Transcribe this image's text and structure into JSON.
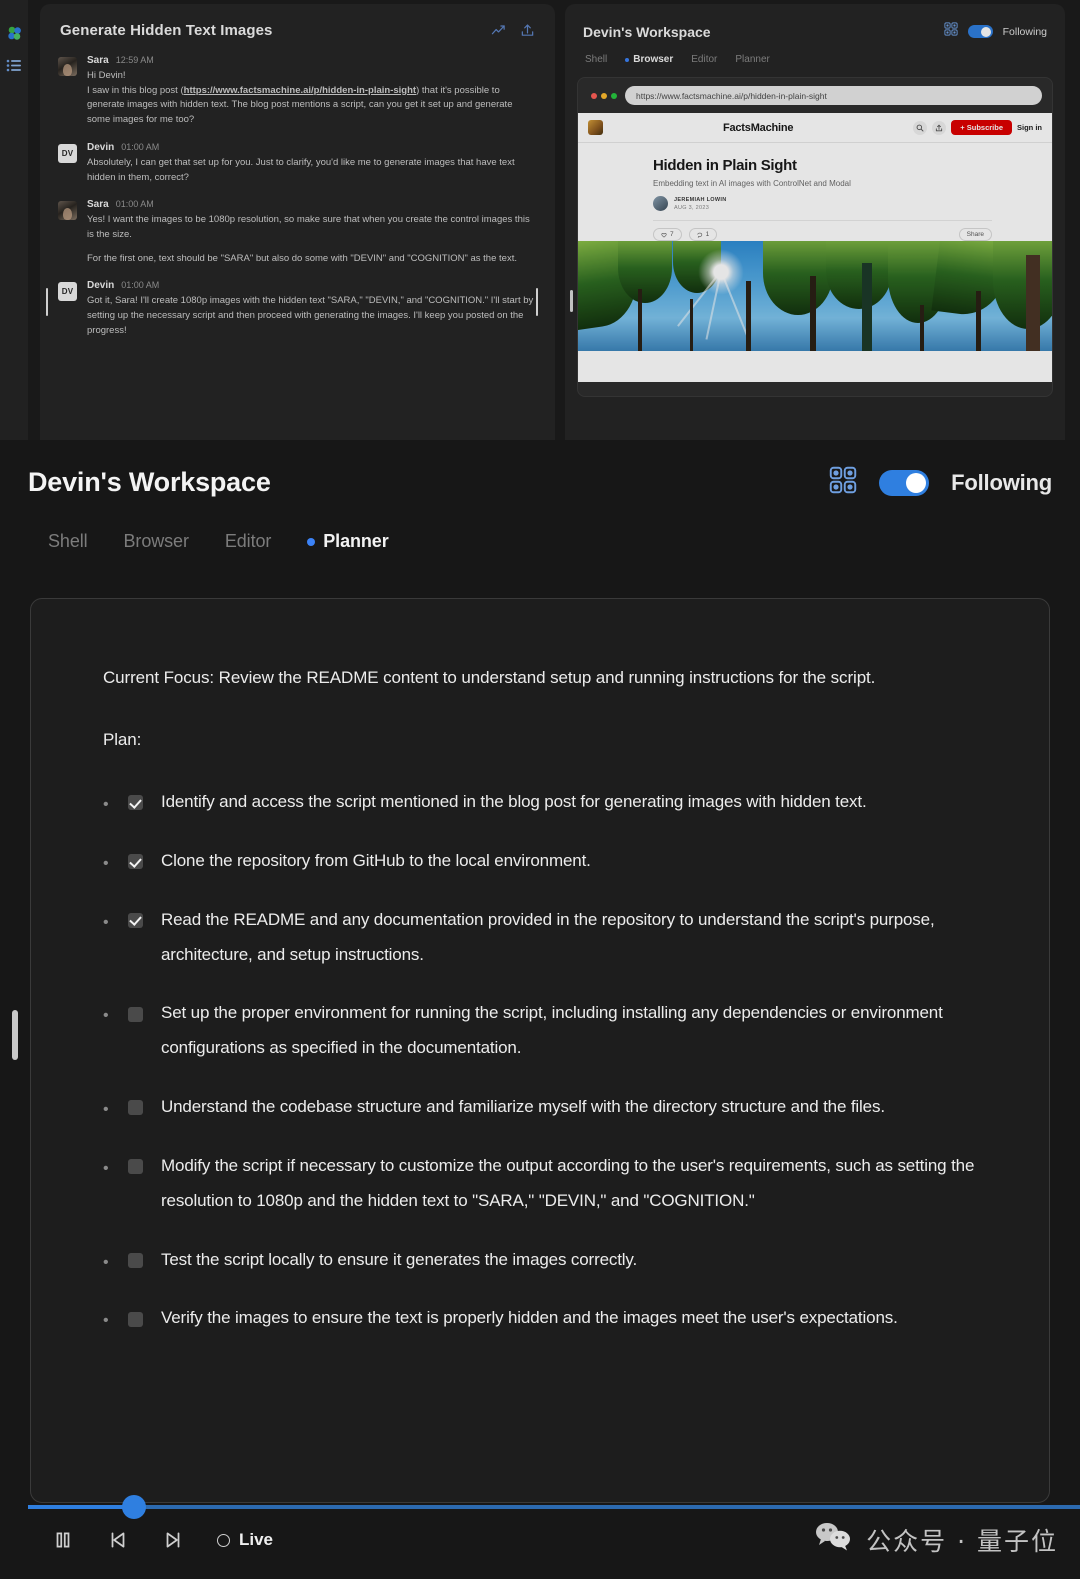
{
  "rail": {
    "logo_icon": "clover-logo-icon",
    "list_icon": "list-icon"
  },
  "chat": {
    "title": "Generate Hidden Text Images",
    "icons": [
      {
        "name": "analytics-icon"
      },
      {
        "name": "share-icon"
      }
    ],
    "messages": [
      {
        "avatar_type": "photo",
        "initials": "",
        "name": "Sara",
        "time": "12:59 AM",
        "lines": [
          "Hi Devin!",
          "I saw in this blog post (https://www.factsmachine.ai/p/hidden-in-plain-sight) that it's possible to generate images with hidden text. The blog post mentions a script, can you get it set up and generate some images for me too?"
        ],
        "link_text": "https://www.factsmachine.ai/p/hidden-in-plain-sight",
        "pre_link": "I saw in this blog post (",
        "post_link": ") that it's possible to generate images with hidden text. The blog post mentions a script, can you get it set up and generate some images for me too?"
      },
      {
        "avatar_type": "initials",
        "initials": "DV",
        "name": "Devin",
        "time": "01:00 AM",
        "lines": [
          "Absolutely, I can get that set up for you. Just to clarify, you'd like me to generate images that have text hidden in them, correct?"
        ]
      },
      {
        "avatar_type": "photo",
        "initials": "",
        "name": "Sara",
        "time": "01:00 AM",
        "lines": [
          "Yes! I want the images to be 1080p resolution, so make sure that when you create the control images this is the size.",
          "For the first one, text should be \"SARA\" but also do some with \"DEVIN\" and \"COGNITION\" as the text."
        ]
      },
      {
        "avatar_type": "initials",
        "initials": "DV",
        "name": "Devin",
        "time": "01:00 AM",
        "lines": [
          "Got it, Sara! I'll create 1080p images with the hidden text \"SARA,\" \"DEVIN,\" and \"COGNITION.\" I'll start by setting up the necessary script and then proceed with generating the images. I'll keep you posted on the progress!"
        ]
      }
    ]
  },
  "workspace_small": {
    "title": "Devin's Workspace",
    "grid_icon": "grid-icon",
    "following_label": "Following",
    "toggle_on": true,
    "tabs": [
      {
        "label": "Shell",
        "active": false
      },
      {
        "label": "Browser",
        "active": true
      },
      {
        "label": "Editor",
        "active": false
      },
      {
        "label": "Planner",
        "active": false
      }
    ],
    "browser": {
      "url": "https://www.factsmachine.ai/p/hidden-in-plain-sight",
      "traffic_lights": [
        "#ff5f57",
        "#febc2e",
        "#28c840"
      ],
      "site": {
        "brand": "FactsMachine",
        "logo_icon": "site-logo-icon",
        "search_icon": "search-icon",
        "share_icon": "share-icon",
        "subscribe_label": "Subscribe",
        "signin_label": "Sign in",
        "post_title": "Hidden in Plain Sight",
        "post_subtitle": "Embedding text in AI images with ControlNet and Modal",
        "author": "JEREMIAH LOWIN",
        "date": "AUG 3, 2023",
        "likes": "7",
        "comments": "1",
        "share_label": "Share",
        "hero_alt": "forest canopy with sun rays"
      }
    }
  },
  "workspace_main": {
    "title": "Devin's Workspace",
    "grid_icon": "grid-icon",
    "following_label": "Following",
    "toggle_on": true,
    "tabs": [
      {
        "label": "Shell",
        "active": false
      },
      {
        "label": "Browser",
        "active": false
      },
      {
        "label": "Editor",
        "active": false
      },
      {
        "label": "Planner",
        "active": true
      }
    ],
    "planner": {
      "current_focus": "Current Focus: Review the README content to understand setup and running instructions for the script.",
      "plan_label": "Plan:",
      "items": [
        {
          "checked": true,
          "text": "Identify and access the script mentioned in the blog post for generating images with hidden text."
        },
        {
          "checked": true,
          "text": "Clone the repository from GitHub to the local environment."
        },
        {
          "checked": true,
          "text": "Read the README and any documentation provided in the repository to understand the script's purpose, architecture, and setup instructions."
        },
        {
          "checked": false,
          "text": "Set up the proper environment for running the script, including installing any dependencies or environment configurations as specified in the documentation."
        },
        {
          "checked": false,
          "text": "Understand the codebase structure and familiarize myself with the directory structure and the files."
        },
        {
          "checked": false,
          "text": "Modify the script if necessary to customize the output according to the user's requirements, such as setting the resolution to 1080p and the hidden text to \"SARA,\" \"DEVIN,\" and \"COGNITION.\""
        },
        {
          "checked": false,
          "text": "Test the script locally to ensure it generates the images correctly."
        },
        {
          "checked": false,
          "text": "Verify the images to ensure the text is properly hidden and the images meet the user's expectations."
        }
      ]
    }
  },
  "player": {
    "pause_icon": "pause-icon",
    "prev_icon": "skip-previous-icon",
    "next_icon": "skip-next-icon",
    "live_label": "Live",
    "progress_percent": 9,
    "accent": "#2f7fe0"
  },
  "watermark": {
    "icon": "wechat-icon",
    "text": "公众号 · 量子位"
  }
}
